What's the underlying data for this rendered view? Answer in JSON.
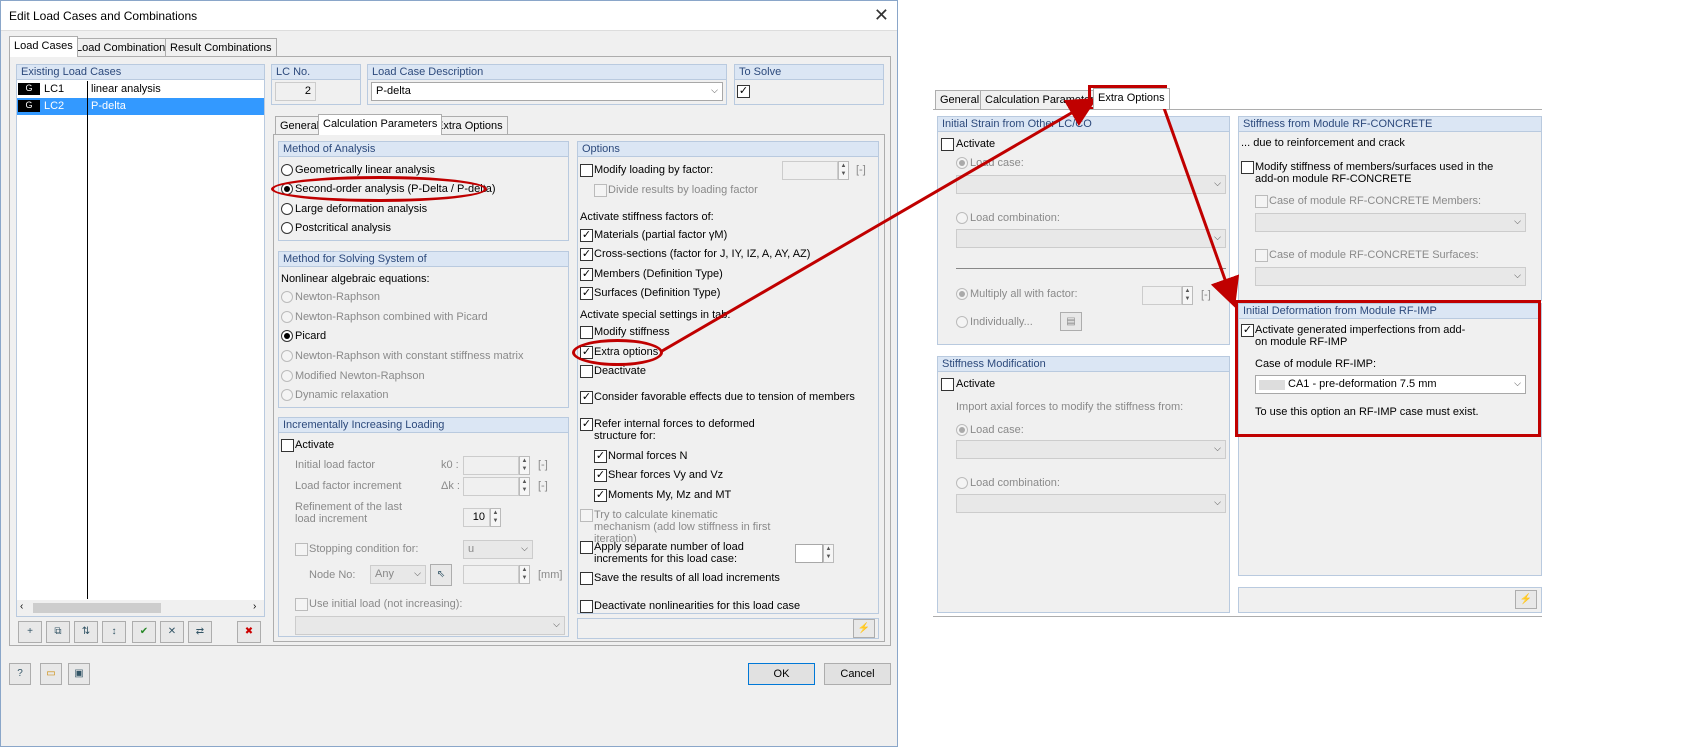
{
  "window": {
    "title": "Edit Load Cases and Combinations",
    "close": "✕"
  },
  "tabs": {
    "load_cases": "Load Cases",
    "load_combinations": "Load Combinations",
    "result_combinations": "Result Combinations"
  },
  "existing": {
    "header": "Existing Load Cases",
    "rows": [
      {
        "type": "G",
        "id": "LC1",
        "name": "linear analysis"
      },
      {
        "type": "G",
        "id": "LC2",
        "name": "P-delta"
      }
    ]
  },
  "lc_no": {
    "label": "LC No.",
    "value": "2"
  },
  "description": {
    "label": "Load Case Description",
    "value": "P-delta"
  },
  "to_solve": {
    "label": "To Solve"
  },
  "inner_tabs": {
    "general": "General",
    "calc": "Calculation Parameters",
    "extra": "Extra Options"
  },
  "method": {
    "header": "Method of Analysis",
    "options": [
      "Geometrically linear analysis",
      "Second-order analysis (P-Delta / P-delta)",
      "Large deformation analysis",
      "Postcritical analysis"
    ]
  },
  "solving": {
    "header": "Method for Solving System of",
    "subtitle": "Nonlinear algebraic equations:",
    "options": [
      "Newton-Raphson",
      "Newton-Raphson combined with Picard",
      "Picard",
      "Newton-Raphson with constant stiffness matrix",
      "Modified Newton-Raphson",
      "Dynamic relaxation"
    ]
  },
  "incr": {
    "header": "Incrementally Increasing Loading",
    "activate": "Activate",
    "initial_factor": "Initial load factor",
    "initial_sym": "k0 :",
    "factor_incr": "Load factor increment",
    "factor_sym": "Δk :",
    "unit_bracket": "[-]",
    "refinement": "Refinement of the last load increment",
    "refinement_value": "10",
    "stopping": "Stopping condition for:",
    "stopping_val": "u",
    "node_no": "Node No:",
    "node_val": "Any",
    "mm": "[mm]",
    "use_initial": "Use initial load (not increasing):"
  },
  "options": {
    "header": "Options",
    "modify_loading": "Modify loading by factor:",
    "unit": "[-]",
    "divide": "Divide results by loading factor",
    "stiff_header": "Activate stiffness factors of:",
    "materials": "Materials (partial factor γM)",
    "cross": "Cross-sections (factor for J, IY, IZ, A, AY, AZ)",
    "members": "Members (Definition Type)",
    "surfaces": "Surfaces (Definition Type)",
    "special_header": "Activate special settings in tab:",
    "modify_stiffness": "Modify stiffness",
    "extra": "Extra options",
    "deactivate": "Deactivate",
    "favorable": "Consider favorable effects due to tension of members",
    "refer": "Refer internal forces to deformed structure for:",
    "normal": "Normal forces N",
    "shear": "Shear forces Vy and Vz",
    "moments": "Moments My, Mz and MT",
    "kinematic": "Try to calculate kinematic mechanism (add low stiffness in first iteration)",
    "separate": "Apply separate number of load increments for this load case:",
    "save_all": "Save the results of all load increments",
    "deact_nonlin": "Deactivate nonlinearities for this load case"
  },
  "buttons": {
    "ok": "OK",
    "cancel": "Cancel"
  },
  "right": {
    "tabs": {
      "general": "General",
      "calc": "Calculation Parameters",
      "extra": "Extra Options"
    },
    "initial_strain": {
      "header": "Initial Strain from Other LC/CO",
      "activate": "Activate",
      "load_case": "Load case:",
      "load_comb": "Load combination:",
      "multiply": "Multiply all with factor:",
      "unit": "[-]",
      "individually": "Individually..."
    },
    "stiff_mod": {
      "header": "Stiffness Modification",
      "activate": "Activate",
      "import": "Import axial forces to modify the stiffness from:",
      "load_case": "Load case:",
      "load_comb": "Load combination:"
    },
    "rfconcrete": {
      "header": "Stiffness from Module RF-CONCRETE",
      "due": "... due to reinforcement and crack",
      "modify": "Modify stiffness of members/surfaces used in the add-on module RF-CONCRETE",
      "members": "Case of module RF-CONCRETE Members:",
      "surfaces": "Case of module RF-CONCRETE Surfaces:"
    },
    "rfimp": {
      "header": "Initial Deformation from Module RF-IMP",
      "activate": "Activate generated imperfections from add-on module RF-IMP",
      "case_label": "Case of module RF-IMP:",
      "case_value": "CA1 - pre-deformation  7.5 mm",
      "note": "To use this option an RF-IMP case must exist."
    }
  },
  "colors": {
    "highlight": "#c00000",
    "selection": "#3399ff",
    "group_header": "#dbe6f4"
  }
}
